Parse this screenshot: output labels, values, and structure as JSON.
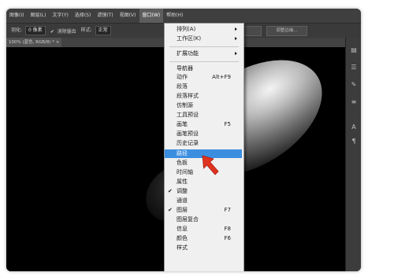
{
  "menubar": {
    "items": [
      {
        "label": "图像(I)"
      },
      {
        "label": "图层(L)"
      },
      {
        "label": "文字(Y)"
      },
      {
        "label": "选择(S)"
      },
      {
        "label": "滤镜(T)"
      },
      {
        "label": "视图(V)"
      },
      {
        "label": "窗口(W)"
      },
      {
        "label": "帮助(H)"
      }
    ],
    "active": "窗口(W)"
  },
  "options_bar": {
    "feather_label": "羽化:",
    "feather_value": "0 像素",
    "antialias_label": "消除锯齿",
    "style_label": "样式:",
    "style_value": "正常",
    "refine_button": "调整边缘..."
  },
  "doc_tab": {
    "label": "100% (蓝色, RGB/8) *",
    "close": "×"
  },
  "window_menu": {
    "items": [
      {
        "label": "排列(A)",
        "submenu": true
      },
      {
        "label": "工作区(K)",
        "submenu": true
      },
      {
        "label": "扩展功能",
        "submenu": true
      },
      {
        "label": "导航器"
      },
      {
        "label": "动作",
        "shortcut": "Alt+F9"
      },
      {
        "label": "段落"
      },
      {
        "label": "段落样式"
      },
      {
        "label": "仿制源"
      },
      {
        "label": "工具预设"
      },
      {
        "label": "画笔",
        "shortcut": "F5"
      },
      {
        "label": "画笔预设"
      },
      {
        "label": "历史记录"
      },
      {
        "label": "路径",
        "selected": true
      },
      {
        "label": "色板"
      },
      {
        "label": "时间轴"
      },
      {
        "label": "属性"
      },
      {
        "label": "调整",
        "checked": true
      },
      {
        "label": "通道"
      },
      {
        "label": "图层",
        "shortcut": "F7",
        "checked": true
      },
      {
        "label": "图层复合"
      },
      {
        "label": "信息",
        "shortcut": "F8"
      },
      {
        "label": "颜色",
        "shortcut": "F6"
      },
      {
        "label": "样式"
      }
    ]
  },
  "colors": {
    "menu_highlight": "#3c8fe0",
    "annotation_arrow": "#e0331f"
  },
  "check_glyph": "✔"
}
